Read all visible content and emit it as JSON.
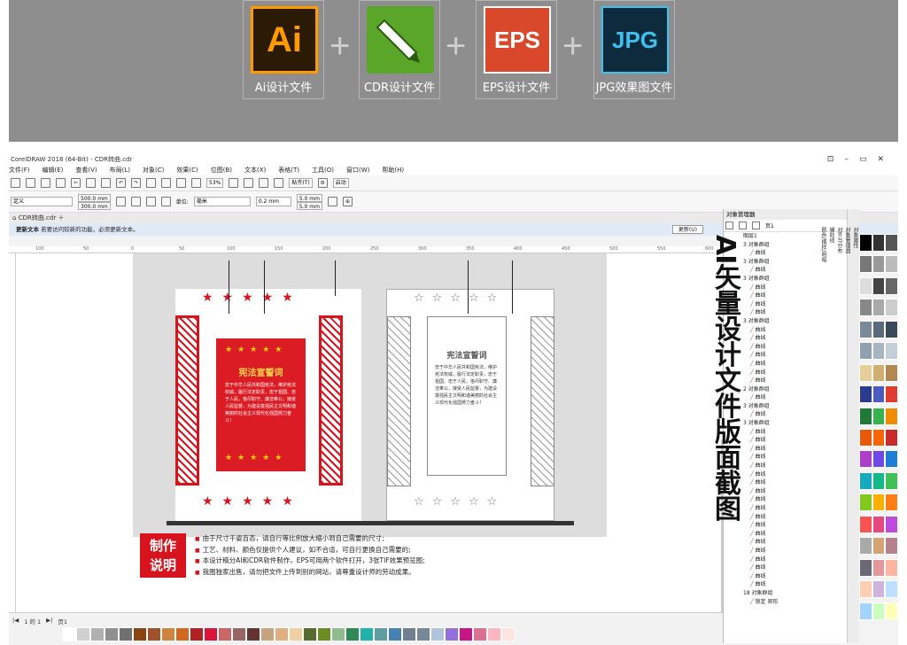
{
  "formats": [
    {
      "icon_text": "Ai",
      "caption": "Ai设计文件",
      "bg": "#2b1b04",
      "fg": "#ff9a00"
    },
    {
      "icon_text": "",
      "caption": "CDR设计文件",
      "bg": "#5aa628",
      "fg": "#ffffff"
    },
    {
      "icon_text": "EPS",
      "caption": "EPS设计文件",
      "bg": "#d9482b",
      "fg": "#ffffff"
    },
    {
      "icon_text": "JPG",
      "caption": "JPG效果图文件",
      "bg": "#0d2b3d",
      "fg": "#3fc1f0"
    }
  ],
  "app": {
    "title": "CorelDRAW 2018 (64-Bit) - CDR转曲.cdr",
    "menu": [
      "文件(F)",
      "编辑(E)",
      "查看(V)",
      "布局(L)",
      "对象(C)",
      "效果(C)",
      "位图(B)",
      "文本(X)",
      "表格(T)",
      "工具(O)",
      "窗口(W)",
      "帮助(H)"
    ],
    "zoom": "53%",
    "snap_label": "贴齐(T)",
    "launch_label": "启动",
    "preset": "定义",
    "width": "500.0 mm",
    "height": "300.0 mm",
    "units_label": "单位:",
    "units": "毫米",
    "nudge": "0.2 mm",
    "dup_x": "5.0 mm",
    "dup_y": "5.0 mm",
    "doc_tab": "CDR转曲.cdr",
    "notify_title": "更新文本",
    "notify_text": "若要访问较新的功能，必须更新文本。",
    "update_button": "更新(U)",
    "page_nav": "1 的 1",
    "page_tab": "页1"
  },
  "ruler_ticks": [
    "100",
    "50",
    "0",
    "50",
    "100",
    "150",
    "200",
    "250",
    "300",
    "350",
    "400",
    "450",
    "500",
    "550",
    "600"
  ],
  "design": {
    "board_title": "宪法宣誓词",
    "board_text": "忠于中华人民共和国宪法，维护宪法权威，履行法定职责，忠于祖国、忠于人民，恪尽职守、廉洁奉公，接受人民监督，为建设富强民主文明和谐美丽的社会主义现代化强国努力奋斗！",
    "outline_title": "宪法宣誓词",
    "outline_text": "忠于中华人民共和国宪法，维护宪法权威，履行法定职责，忠于祖国、忠于人民，恪尽职守、廉洁奉公，接受人民监督，为建设富强民主文明和谐美丽的社会主义现代化强国努力奋斗！",
    "star5": "★★★★★",
    "ostar5": "☆☆☆☆☆"
  },
  "notes": {
    "badge_line1": "制作",
    "badge_line2": "说明",
    "items": [
      "由于尺寸千姿百态，请自行等比例放大缩小到自己需要的尺寸;",
      "工艺、材料、颜色仅提供个人建议，如不合适，可自行更换自己需要的;",
      "本设计稿分AI和CDR软件制作，EPS可用两个软件打开，3张TIF效果预览图;",
      "我图独家出售，请勿把文件上传到别的网站，请尊重设计师的劳动成果。"
    ]
  },
  "side_title": "AI矢量设计文件版面截图",
  "object_manager": {
    "header": "对象管理器",
    "page": "页1",
    "layer": "图层1",
    "items": [
      "3 对象群组",
      "曲线",
      "3 对象群组",
      "曲线",
      "3 对象群组",
      "曲线",
      "曲线",
      "曲线",
      "曲线",
      "3 对象群组",
      "曲线",
      "曲线",
      "曲线",
      "曲线",
      "曲线",
      "曲线",
      "曲线",
      "2 对象群组",
      "曲线",
      "3 对象群组",
      "曲线",
      "3 对象群组",
      "曲线",
      "曲线",
      "曲线",
      "曲线",
      "曲线",
      "曲线",
      "曲线",
      "曲线",
      "曲线",
      "曲线",
      "曲线",
      "曲线",
      "曲线",
      "曲线",
      "曲线",
      "曲线",
      "曲线",
      "曲线",
      "曲线",
      "18 对象群组",
      "锁定 矩形"
    ]
  },
  "dockers": [
    "对象属性",
    "对象管理器",
    "对齐与分布",
    "辅助线",
    "颜色/模样/明暗"
  ],
  "palette_v": [
    "#000",
    "#333",
    "#555",
    "#777",
    "#999",
    "#bbb",
    "#ddd",
    "#444",
    "#666",
    "#888",
    "#aaa",
    "#ccc",
    "#7a8a9a",
    "#5a6a7a",
    "#3a4a5a",
    "#8fa0b0",
    "#a7b5c2",
    "#c3cfd8",
    "#e6d09a",
    "#d0b070",
    "#b08850",
    "#2b3b8f",
    "#4b5bbf",
    "#e03c31",
    "#1f7a3a",
    "#37b24d",
    "#f08c00",
    "#e8590c",
    "#f76707",
    "#c92a2a",
    "#ae3ec9",
    "#7048e8",
    "#1c7ed6",
    "#15aabf",
    "#12b886",
    "#40c057",
    "#82c91e",
    "#fab005",
    "#fd7e14",
    "#fa5252",
    "#e64980",
    "#be4bdb",
    "#a9a9a9",
    "#d4a373",
    "#b5838d",
    "#6d6875",
    "#e5989b",
    "#ffb4a2",
    "#ffcdb2",
    "#cdb4db",
    "#bde0fe",
    "#a2d2ff",
    "#caffbf",
    "#fdffb6"
  ],
  "palette_h": [
    "#ffffff",
    "#d0d0d0",
    "#b0b0b0",
    "#909090",
    "#707070",
    "#8b4513",
    "#a0522d",
    "#cd853f",
    "#d2691e",
    "#b22222",
    "#dc143c",
    "#cc6666",
    "#996666",
    "#663333",
    "#c9a27e",
    "#e0b080",
    "#f0d0a0",
    "#556b2f",
    "#6b8e23",
    "#8fbc8f",
    "#2e8b57",
    "#20b2aa",
    "#5f9ea0",
    "#4682b4",
    "#708090",
    "#778899",
    "#b0c4de",
    "#9370db",
    "#c71585",
    "#db7093",
    "#ffb6c1",
    "#ffe4e1"
  ]
}
